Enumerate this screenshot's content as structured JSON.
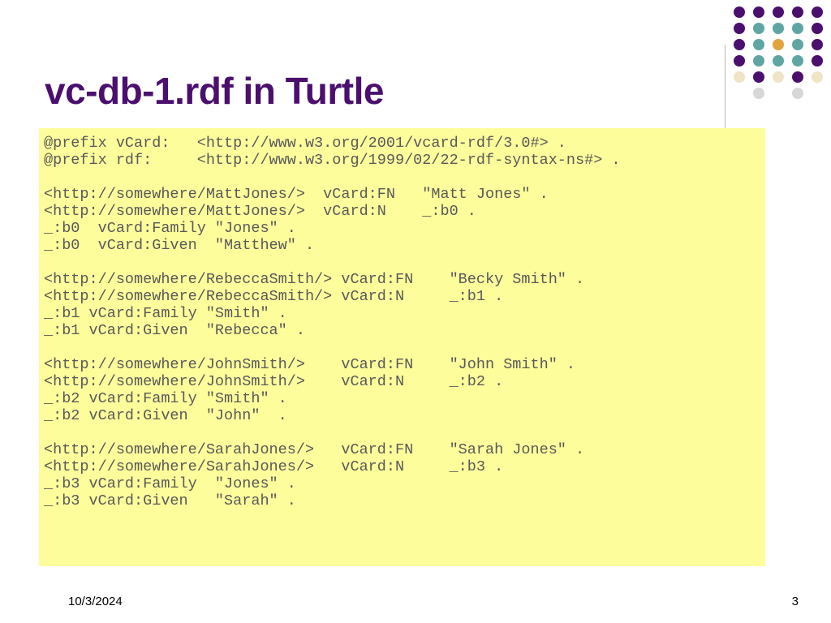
{
  "title": "vc-db-1.rdf in Turtle",
  "code": "@prefix vCard:   <http://www.w3.org/2001/vcard-rdf/3.0#> .\n@prefix rdf:     <http://www.w3.org/1999/02/22-rdf-syntax-ns#> .\n\n<http://somewhere/MattJones/>  vCard:FN   \"Matt Jones\" .\n<http://somewhere/MattJones/>  vCard:N    _:b0 .\n_:b0  vCard:Family \"Jones\" .\n_:b0  vCard:Given  \"Matthew\" .\n\n<http://somewhere/RebeccaSmith/> vCard:FN    \"Becky Smith\" .\n<http://somewhere/RebeccaSmith/> vCard:N     _:b1 .\n_:b1 vCard:Family \"Smith\" .\n_:b1 vCard:Given  \"Rebecca\" .\n\n<http://somewhere/JohnSmith/>    vCard:FN    \"John Smith\" .\n<http://somewhere/JohnSmith/>    vCard:N     _:b2 .\n_:b2 vCard:Family \"Smith\" .\n_:b2 vCard:Given  \"John\"  .\n\n<http://somewhere/SarahJones/>   vCard:FN    \"Sarah Jones\" .\n<http://somewhere/SarahJones/>   vCard:N     _:b3 .\n_:b3 vCard:Family  \"Jones\" .\n_:b3 vCard:Given   \"Sarah\" .",
  "footer": {
    "date": "10/3/2024",
    "page": "3"
  }
}
